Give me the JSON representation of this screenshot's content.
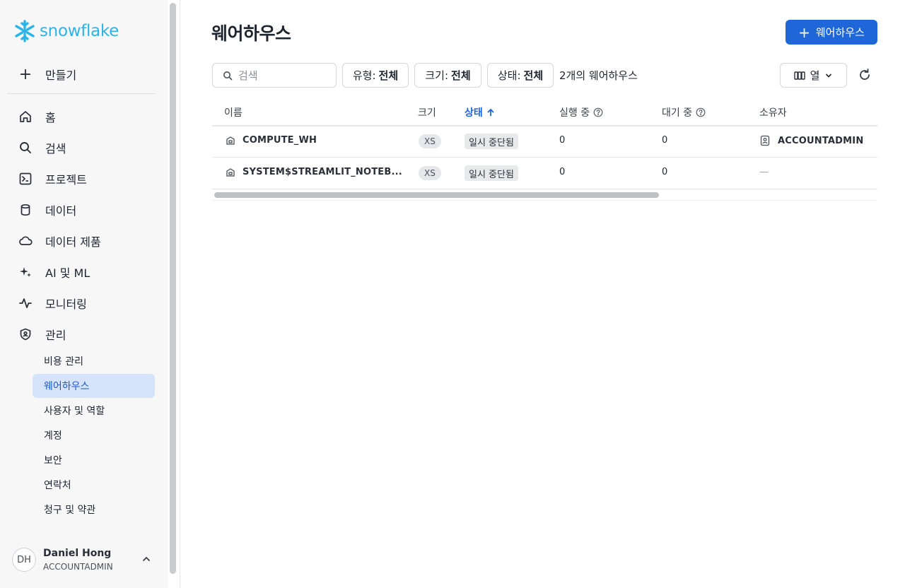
{
  "sidebar": {
    "logo_text": "snowflake",
    "brand_color": "#29b5e8",
    "create_label": "만들기",
    "nav": [
      {
        "label": "홈",
        "icon": "home-icon"
      },
      {
        "label": "검색",
        "icon": "search-icon"
      },
      {
        "label": "프로젝트",
        "icon": "terminal-icon"
      },
      {
        "label": "데이터",
        "icon": "database-icon"
      },
      {
        "label": "데이터 제품",
        "icon": "cloud-icon"
      },
      {
        "label": "AI 및 ML",
        "icon": "sparkle-icon"
      },
      {
        "label": "모니터링",
        "icon": "activity-icon"
      },
      {
        "label": "관리",
        "icon": "shield-icon"
      }
    ],
    "admin_sub": [
      {
        "label": "비용 관리",
        "active": false
      },
      {
        "label": "웨어하우스",
        "active": true
      },
      {
        "label": "사용자 및 역할",
        "active": false
      },
      {
        "label": "계정",
        "active": false
      },
      {
        "label": "보안",
        "active": false
      },
      {
        "label": "연락처",
        "active": false
      },
      {
        "label": "청구 및 약관",
        "active": false
      }
    ],
    "user": {
      "initials": "DH",
      "name": "Daniel Hong",
      "role": "ACCOUNTADMIN"
    }
  },
  "main": {
    "title": "웨어하우스",
    "create_button": "웨어하우스",
    "search_placeholder": "검색",
    "filters": [
      {
        "label": "유형:",
        "value": "전체"
      },
      {
        "label": "크기:",
        "value": "전체"
      },
      {
        "label": "상태:",
        "value": "전체"
      }
    ],
    "count_text": "2개의 웨어하우스",
    "columns_button": "열",
    "accent_color": "#1f67d8",
    "table": {
      "headers": {
        "name": "이름",
        "size": "크기",
        "status": "상태",
        "running": "실행 중",
        "queued": "대기 중",
        "owner": "소유자"
      },
      "rows": [
        {
          "name": "COMPUTE_WH",
          "size": "XS",
          "status": "일시 중단됨",
          "running": "0",
          "queued": "0",
          "owner": "ACCOUNTADMIN"
        },
        {
          "name": "SYSTEM$STREAMLIT_NOTEB...",
          "size": "XS",
          "status": "일시 중단됨",
          "running": "0",
          "queued": "0",
          "owner": "—"
        }
      ]
    }
  }
}
